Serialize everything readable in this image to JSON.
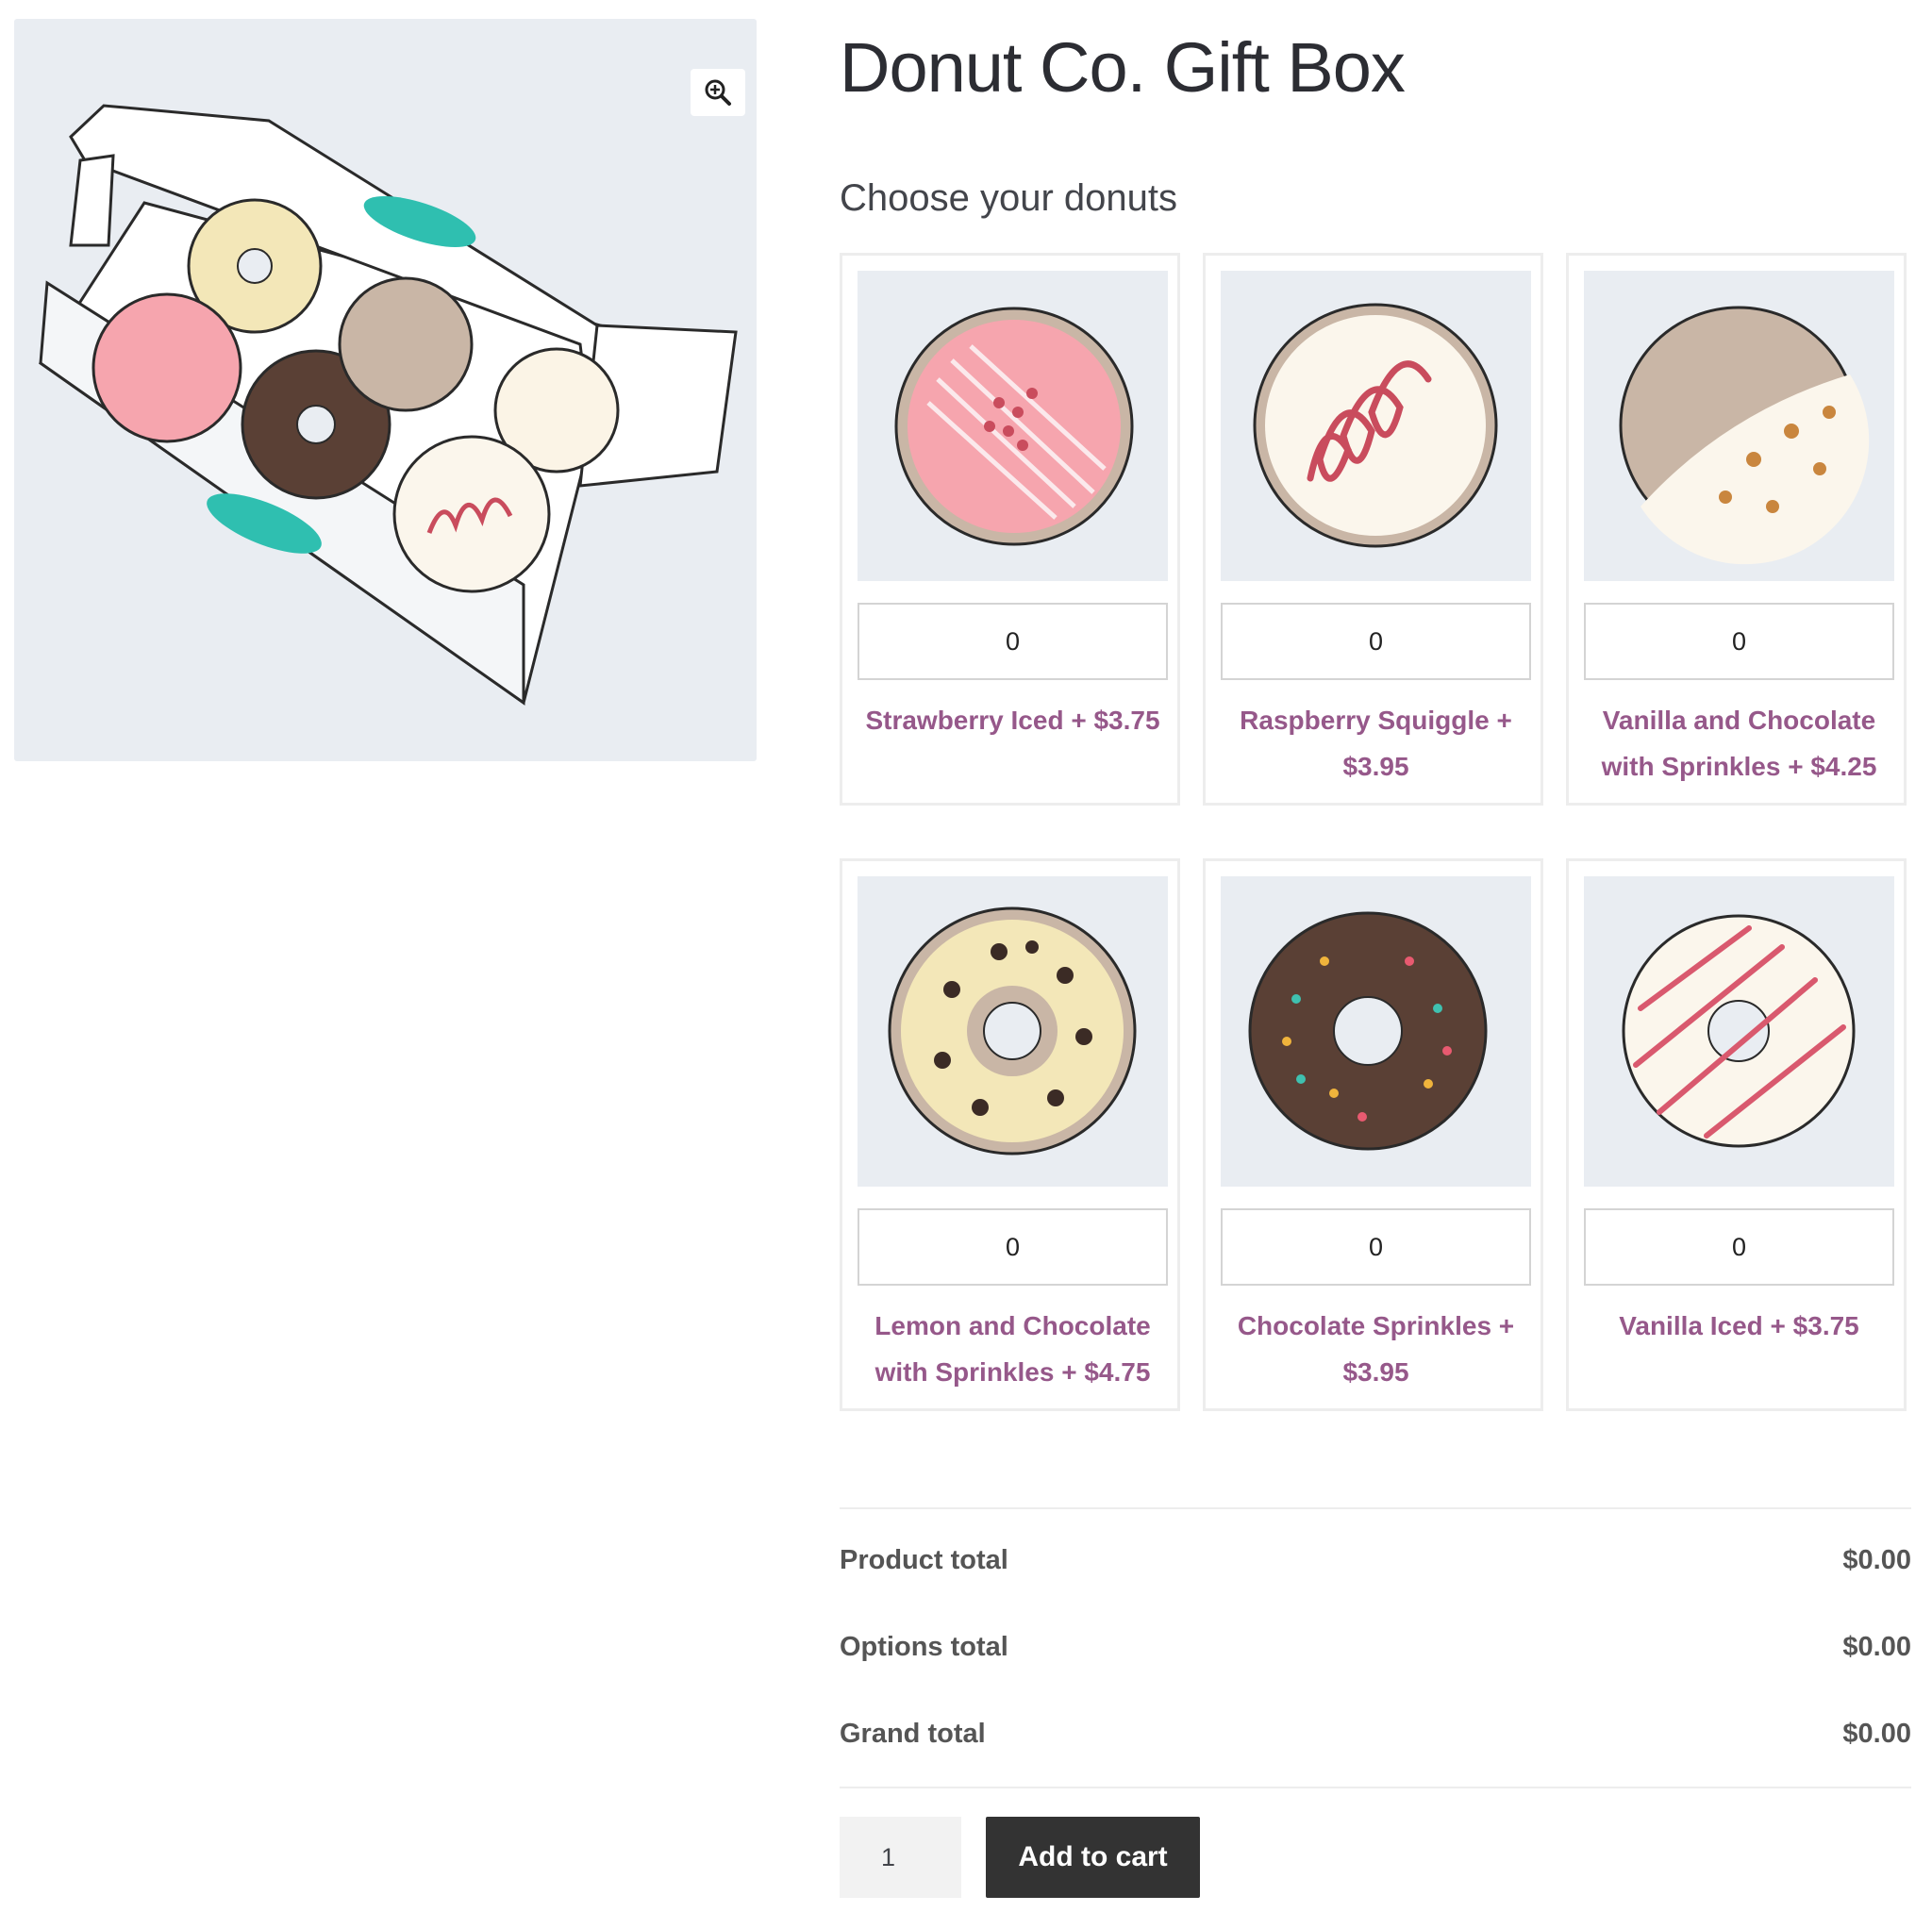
{
  "product": {
    "title": "Donut Co. Gift Box",
    "options_heading": "Choose your donuts",
    "gallery_icon": "magnifier-plus-icon",
    "donuts": [
      {
        "label": "Strawberry Iced + $3.75",
        "qty": "0"
      },
      {
        "label": "Raspberry Squiggle + $3.95",
        "qty": "0"
      },
      {
        "label": "Vanilla and Chocolate with Sprinkles + $4.25",
        "qty": "0"
      },
      {
        "label": "Lemon and Chocolate with Sprinkles + $4.75",
        "qty": "0"
      },
      {
        "label": "Chocolate Sprinkles + $3.95",
        "qty": "0"
      },
      {
        "label": "Vanilla Iced + $3.75",
        "qty": "0"
      }
    ]
  },
  "totals": {
    "product_label": "Product total",
    "product_value": "$0.00",
    "options_label": "Options total",
    "options_value": "$0.00",
    "grand_label": "Grand total",
    "grand_value": "$0.00"
  },
  "cart": {
    "qty": "1",
    "button_label": "Add to cart"
  },
  "colors": {
    "accent": "#96588a",
    "button": "#333333",
    "image_bg": "#e9edf2"
  }
}
